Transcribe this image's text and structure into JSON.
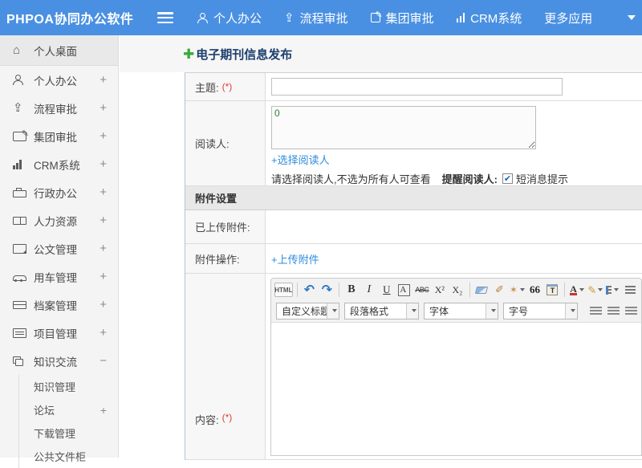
{
  "app": {
    "title": "PHPOA协同办公软件"
  },
  "header": {
    "nav": [
      {
        "label": "个人办公",
        "icon": "person-icon"
      },
      {
        "label": "流程审批",
        "icon": "flow-icon"
      },
      {
        "label": "集团审批",
        "icon": "edit-icon"
      },
      {
        "label": "CRM系统",
        "icon": "chart-icon"
      },
      {
        "label": "更多应用",
        "icon": "caret-down-icon"
      }
    ]
  },
  "sidebar": {
    "items": [
      {
        "label": "个人桌面",
        "expand": "",
        "icon": "home-icon",
        "active": true
      },
      {
        "label": "个人办公",
        "expand": "+",
        "icon": "person-icon"
      },
      {
        "label": "流程审批",
        "expand": "+",
        "icon": "flow-icon"
      },
      {
        "label": "集团审批",
        "expand": "+",
        "icon": "edit-icon"
      },
      {
        "label": "CRM系统",
        "expand": "+",
        "icon": "chart-icon"
      },
      {
        "label": "行政办公",
        "expand": "+",
        "icon": "briefcase-icon"
      },
      {
        "label": "人力资源",
        "expand": "+",
        "icon": "book-icon"
      },
      {
        "label": "公文管理",
        "expand": "+",
        "icon": "document-icon"
      },
      {
        "label": "用车管理",
        "expand": "+",
        "icon": "car-icon"
      },
      {
        "label": "档案管理",
        "expand": "+",
        "icon": "archive-icon"
      },
      {
        "label": "项目管理",
        "expand": "+",
        "icon": "project-icon"
      },
      {
        "label": "知识交流",
        "expand": "−",
        "icon": "chat-icon"
      }
    ],
    "subitems": [
      {
        "label": "知识管理",
        "expand": ""
      },
      {
        "label": "论坛",
        "expand": "+"
      },
      {
        "label": "下载管理",
        "expand": ""
      },
      {
        "label": "公共文件柜",
        "expand": ""
      }
    ]
  },
  "page": {
    "title": "电子期刊信息发布"
  },
  "form": {
    "subject_label": "主题:",
    "required_mark": "(*)",
    "readers_label": "阅读人:",
    "readers_count": "0",
    "select_readers_link": "+选择阅读人",
    "readers_note": "请选择阅读人,不选为所有人可查看",
    "remind_label": "提醒阅读人:",
    "checkbox_mark": "✔",
    "sms_label": "短消息提示",
    "attach_section": "附件设置",
    "uploaded_label": "已上传附件:",
    "attach_op_label": "附件操作:",
    "upload_link": "+上传附件",
    "content_label": "内容:"
  },
  "editor": {
    "html_btn": "HTML",
    "undo": "↶",
    "redo": "↷",
    "bold": "B",
    "italic": "I",
    "underline": "U",
    "box_a": "A",
    "strike": "ABC",
    "superscript": "X²",
    "subscript": "X₂",
    "brush": "✐",
    "wand": "✶",
    "quote": "66",
    "paste_t": "T",
    "color_a": "A",
    "marker": "✐",
    "link_glyph": "∞",
    "unlink_glyph": "∅",
    "selects": [
      {
        "label": "自定义标题"
      },
      {
        "label": "段落格式"
      },
      {
        "label": "字体"
      },
      {
        "label": "字号"
      }
    ]
  },
  "colors": {
    "header_bg": "#4a90e2",
    "link": "#2d8cdb",
    "required_red": "#e03b3b",
    "plus_green": "#3aa93a",
    "reader_count_green": "#2e7d32"
  }
}
